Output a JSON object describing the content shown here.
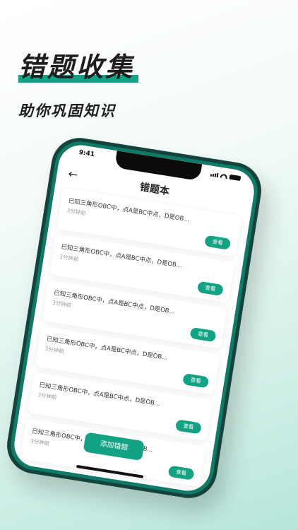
{
  "hero": {
    "title": "错题收集",
    "subtitle": "助你巩固知识"
  },
  "status_bar": {
    "time": "9:41",
    "icons": [
      "signal-icon",
      "wifi-icon",
      "battery-icon"
    ]
  },
  "nav": {
    "back_icon": "←",
    "title": "错题本"
  },
  "cards": [
    {
      "question": "已知三角形OBC中，点A是BC中点，D是OB...",
      "time": "3分钟前",
      "action": "查看"
    },
    {
      "question": "已知三角形OBC中，点A是BC中点，D是OB...",
      "time": "3分钟前",
      "action": "查看"
    },
    {
      "question": "已知三角形OBC中，点A是BC中点，D是OB...",
      "time": "3分钟前",
      "action": "查看"
    },
    {
      "question": "已知三角形OBC中，点A是BC中点，D是OB...",
      "time": "3分钟前",
      "action": "查看"
    },
    {
      "question": "已知三角形OBC中，点A是BC中点，D是OB...",
      "time": "3分钟前",
      "action": "查看"
    },
    {
      "question": "已知三角形OBC中，点A是BC中点，D是OB...",
      "time": "3分钟前",
      "action": "查看"
    }
  ],
  "add_button": "添加错题",
  "colors": {
    "accent": "#13a283",
    "phone_frame": "#0f7a67"
  }
}
